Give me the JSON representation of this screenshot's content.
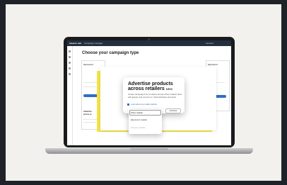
{
  "app": {
    "logo": "amazon ads",
    "nav_tag": "Campaign manager",
    "account_label": "Account"
  },
  "page": {
    "title": "Choose your campaign type"
  },
  "background": {
    "left_card_title": "Sponsored",
    "left_card_sub": "Advertise",
    "left_card_sub2": "across re",
    "right_card_title": "Sponsored"
  },
  "modal": {
    "title_line1": "Advertise products",
    "title_line2": "across retailers",
    "badge": "NEW",
    "description": "Create campaigns for products across other retailers that will appear and convert on retail websites and apps.",
    "link_text": "Learn about any retailer website",
    "continue_label": "Continue"
  },
  "dropdown": {
    "selected": "Store retailer",
    "options": [
      "Store retailer",
      "Electronic retailer",
      "Grocery retailer"
    ]
  },
  "colors": {
    "page_bg": "#1f2226",
    "card_bg": "#f2f1ee",
    "accent_yellow": "#f4e44a",
    "link_blue": "#2f6fc6",
    "topbar": "#232f3e"
  }
}
